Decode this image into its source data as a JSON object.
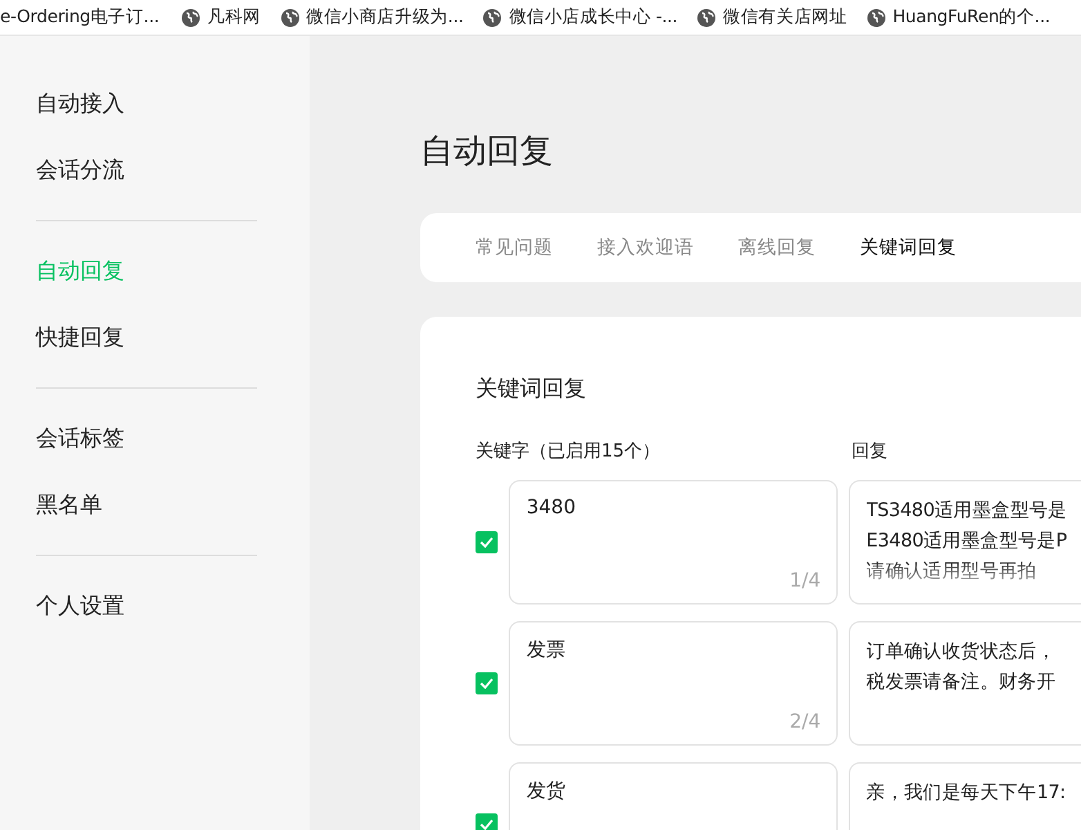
{
  "bookmarks": [
    {
      "label": "e-Ordering电子订...",
      "icon": false
    },
    {
      "label": "凡科网",
      "icon": true
    },
    {
      "label": "微信小商店升级为...",
      "icon": true
    },
    {
      "label": "微信小店成长中心 -...",
      "icon": true
    },
    {
      "label": "微信有关店网址",
      "icon": true
    },
    {
      "label": "HuangFuRen的个...",
      "icon": true
    }
  ],
  "sidebar": {
    "groups": [
      [
        {
          "label": "自动接入",
          "selected": false
        },
        {
          "label": "会话分流",
          "selected": false
        }
      ],
      [
        {
          "label": "自动回复",
          "selected": true
        },
        {
          "label": "快捷回复",
          "selected": false
        }
      ],
      [
        {
          "label": "会话标签",
          "selected": false
        },
        {
          "label": "黑名单",
          "selected": false
        }
      ],
      [
        {
          "label": "个人设置",
          "selected": false
        }
      ]
    ]
  },
  "page_title": "自动回复",
  "tabs": [
    {
      "label": "常见问题",
      "selected": false
    },
    {
      "label": "接入欢迎语",
      "selected": false
    },
    {
      "label": "离线回复",
      "selected": false
    },
    {
      "label": "关键词回复",
      "selected": true
    }
  ],
  "section_title": "关键词回复",
  "columns": {
    "keyword": "关键字（已启用15个）",
    "reply": "回复"
  },
  "rules": [
    {
      "checked": true,
      "keyword": "3480",
      "counter": "1/4",
      "reply": [
        "TS3480适用墨盒型号是",
        "E3480适用墨盒型号是P",
        "请确认适用型号再拍"
      ]
    },
    {
      "checked": true,
      "keyword": "发票",
      "counter": "2/4",
      "reply": [
        "订单确认收货状态后，",
        "税发票请备注。财务开"
      ]
    },
    {
      "checked": true,
      "keyword": "发货",
      "reply": [
        "亲，我们是每天下午17:"
      ]
    }
  ]
}
